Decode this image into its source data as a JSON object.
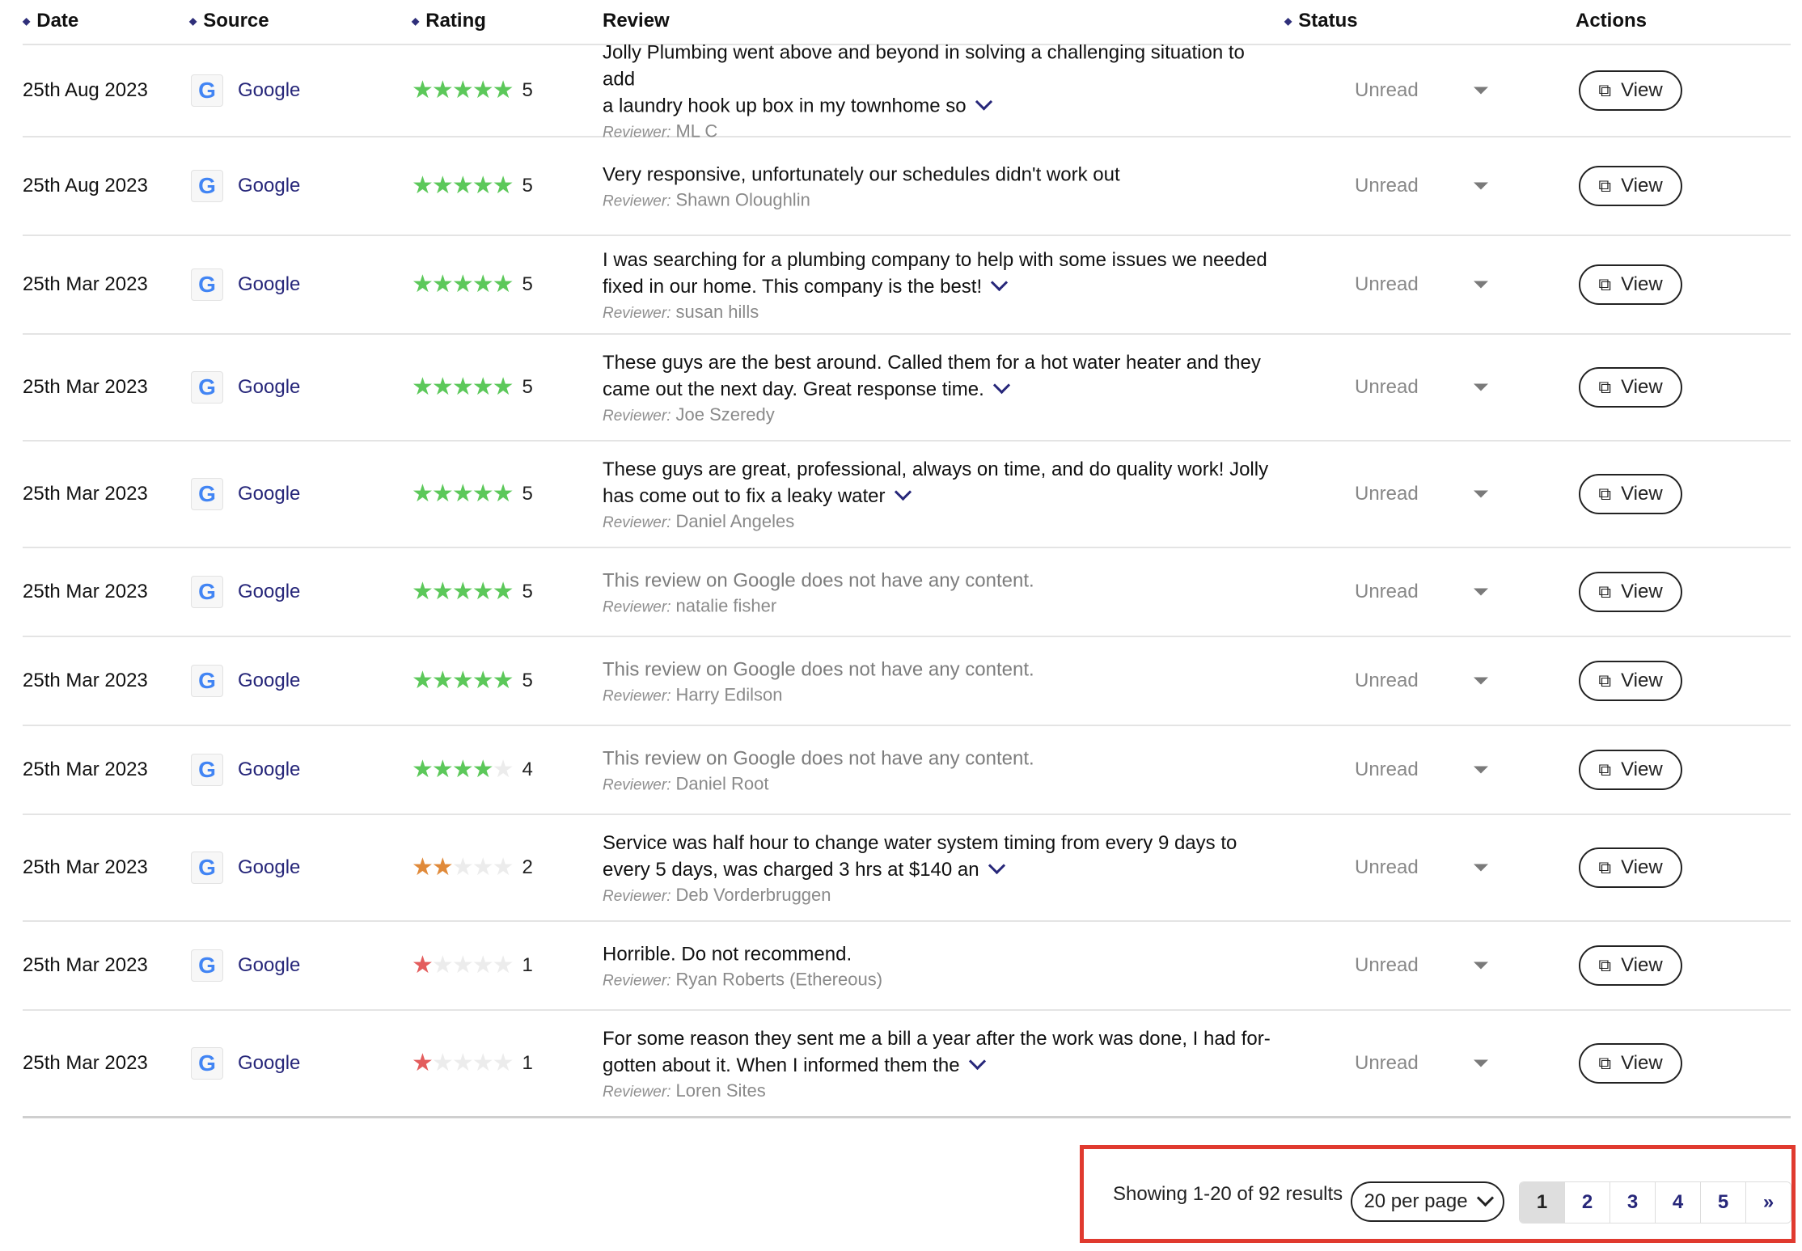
{
  "headers": {
    "date": "Date",
    "source": "Source",
    "rating": "Rating",
    "review": "Review",
    "status": "Status",
    "actions": "Actions"
  },
  "reviewer_label": "Reviewer:",
  "status_label": "Unread",
  "view_label": "View",
  "source_name": "Google",
  "source_icon": "G",
  "colors": {
    "accent": "#27277a",
    "star_high": "#5cc85a",
    "star_mid": "#e08a3a",
    "star_low": "#e35d5d",
    "highlight_border": "#e03a2f"
  },
  "rows": [
    {
      "date": "25th Aug 2023",
      "rating": 5,
      "rating_text": "5",
      "review_lines": [
        "Jolly Plumbing went above and beyond in solving a challenging situation to add",
        "a laundry hook up box in my townhome so"
      ],
      "truncated": true,
      "empty": false,
      "reviewer": "ML C"
    },
    {
      "date": "25th Aug 2023",
      "rating": 5,
      "rating_text": "5",
      "review_lines": [
        "Very responsive, unfortunately our schedules didn't work out"
      ],
      "truncated": false,
      "empty": false,
      "reviewer": "Shawn Oloughlin"
    },
    {
      "date": "25th Mar 2023",
      "rating": 5,
      "rating_text": "5",
      "review_lines": [
        "I was searching for a plumbing company to help with some issues we needed",
        "fixed in our home. This company is the best!"
      ],
      "truncated": true,
      "empty": false,
      "reviewer": "susan hills"
    },
    {
      "date": "25th Mar 2023",
      "rating": 5,
      "rating_text": "5",
      "review_lines": [
        "These guys are the best around. Called them for a hot water heater and they",
        "came out the next day. Great response time."
      ],
      "truncated": true,
      "empty": false,
      "reviewer": "Joe Szeredy"
    },
    {
      "date": "25th Mar 2023",
      "rating": 5,
      "rating_text": "5",
      "review_lines": [
        "These guys are great, professional, always on time, and do quality work! Jolly",
        "has come out to fix a leaky water"
      ],
      "truncated": true,
      "empty": false,
      "reviewer": "Daniel Angeles"
    },
    {
      "date": "25th Mar 2023",
      "rating": 5,
      "rating_text": "5",
      "review_lines": [
        "This review on Google does not have any content."
      ],
      "truncated": false,
      "empty": true,
      "reviewer": "natalie fisher"
    },
    {
      "date": "25th Mar 2023",
      "rating": 5,
      "rating_text": "5",
      "review_lines": [
        "This review on Google does not have any content."
      ],
      "truncated": false,
      "empty": true,
      "reviewer": "Harry Edilson"
    },
    {
      "date": "25th Mar 2023",
      "rating": 4,
      "rating_text": "4",
      "review_lines": [
        "This review on Google does not have any content."
      ],
      "truncated": false,
      "empty": true,
      "reviewer": "Daniel Root"
    },
    {
      "date": "25th Mar 2023",
      "rating": 2,
      "rating_text": "2",
      "review_lines": [
        "Service was half hour to change water system timing from every 9 days to",
        "every 5 days, was charged 3 hrs at $140 an"
      ],
      "truncated": true,
      "empty": false,
      "reviewer": "Deb Vorderbruggen"
    },
    {
      "date": "25th Mar 2023",
      "rating": 1,
      "rating_text": "1",
      "review_lines": [
        "Horrible. Do not recommend."
      ],
      "truncated": false,
      "empty": false,
      "reviewer": "Ryan Roberts (Ethereous)"
    },
    {
      "date": "25th Mar 2023",
      "rating": 1,
      "rating_text": "1",
      "review_lines": [
        "For some reason they sent me a bill a year after the work was done, I had for-",
        "gotten about it. When I informed them the"
      ],
      "truncated": true,
      "empty": false,
      "reviewer": "Loren Sites"
    }
  ],
  "pagination": {
    "showing": "Showing 1-20 of 92 results",
    "per_page": "20 per page",
    "pages": [
      "1",
      "2",
      "3",
      "4",
      "5"
    ],
    "current": "1",
    "next": "»"
  }
}
